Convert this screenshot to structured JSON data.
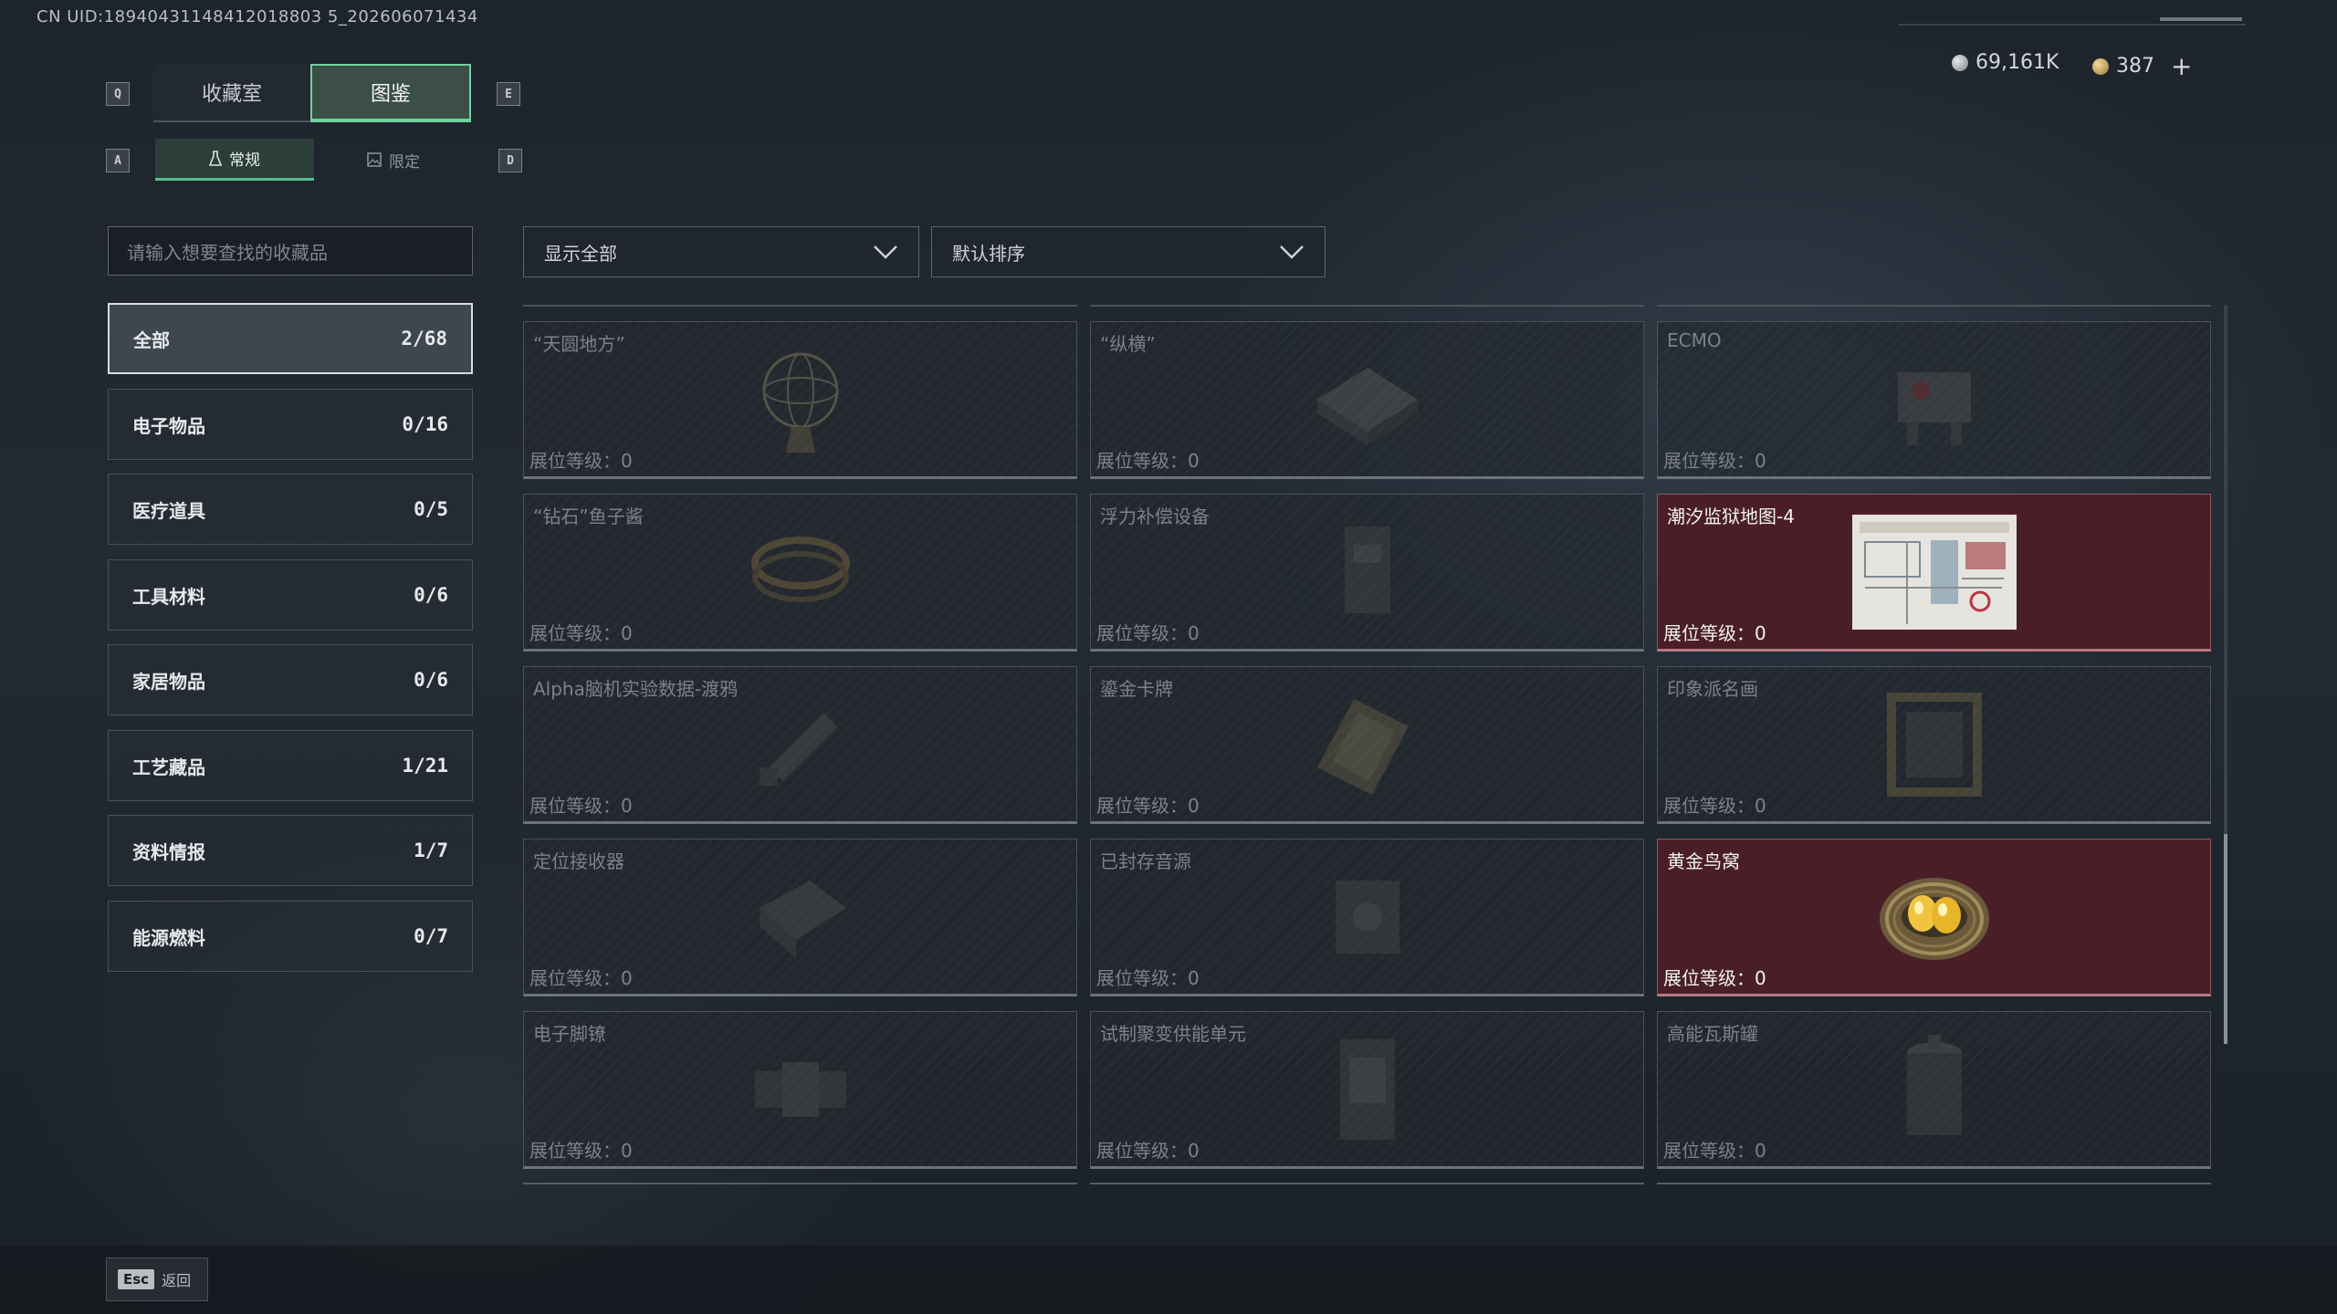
{
  "uid": "CN UID:18940431148412018803 5_202606071434",
  "header": {
    "key_left": "Q",
    "key_right": "E",
    "tabs": [
      {
        "label": "收藏室",
        "active": false
      },
      {
        "label": "图鉴",
        "active": true
      }
    ],
    "subkey_left": "A",
    "subkey_right": "D",
    "subtabs": [
      {
        "label": "常规",
        "icon": "flask-icon",
        "active": true
      },
      {
        "label": "限定",
        "icon": "image-icon",
        "active": false
      }
    ]
  },
  "currency": {
    "silver": "69,161K",
    "gold": "387",
    "add": "+"
  },
  "search": {
    "placeholder": "请输入想要查找的收藏品"
  },
  "filters": {
    "show": "显示全部",
    "sort": "默认排序"
  },
  "categories": [
    {
      "label": "全部",
      "count": "2/68",
      "active": true
    },
    {
      "label": "电子物品",
      "count": "0/16"
    },
    {
      "label": "医疗道具",
      "count": "0/5"
    },
    {
      "label": "工具材料",
      "count": "0/6"
    },
    {
      "label": "家居物品",
      "count": "0/6"
    },
    {
      "label": "工艺藏品",
      "count": "1/21"
    },
    {
      "label": "资料情报",
      "count": "1/7"
    },
    {
      "label": "能源燃料",
      "count": "0/7"
    }
  ],
  "level_label": "展位等级：0",
  "items": [
    {
      "name": "“天圆地方”",
      "owned": false,
      "icon": "armillary-icon"
    },
    {
      "name": "“纵横”",
      "owned": false,
      "icon": "chessboard-icon"
    },
    {
      "name": "ECMO",
      "owned": false,
      "icon": "machine-icon"
    },
    {
      "name": "“钻石”鱼子酱",
      "owned": false,
      "icon": "tin-icon"
    },
    {
      "name": "浮力补偿设备",
      "owned": false,
      "icon": "vest-icon"
    },
    {
      "name": "潮汐监狱地图-4",
      "owned": true,
      "icon": "map-icon"
    },
    {
      "name": "Alpha脑机实验数据-渡鸦",
      "owned": false,
      "icon": "drive-icon"
    },
    {
      "name": "鎏金卡牌",
      "owned": false,
      "icon": "card-icon"
    },
    {
      "name": "印象派名画",
      "owned": false,
      "icon": "painting-icon"
    },
    {
      "name": "定位接收器",
      "owned": false,
      "icon": "receiver-icon"
    },
    {
      "name": "已封存音源",
      "owned": false,
      "icon": "speaker-icon"
    },
    {
      "name": "黄金鸟窝",
      "owned": true,
      "icon": "golden-nest-icon"
    },
    {
      "name": "电子脚镣",
      "owned": false,
      "icon": "anklet-icon"
    },
    {
      "name": "试制聚变供能单元",
      "owned": false,
      "icon": "fusion-cell-icon"
    },
    {
      "name": "高能瓦斯罐",
      "owned": false,
      "icon": "gas-tank-icon"
    }
  ],
  "footer": {
    "esc_key": "Esc",
    "back_label": "返回"
  },
  "colors": {
    "accent": "#6fd39e",
    "owned_bg": "#4a1e27",
    "bg": "#1f262e"
  }
}
